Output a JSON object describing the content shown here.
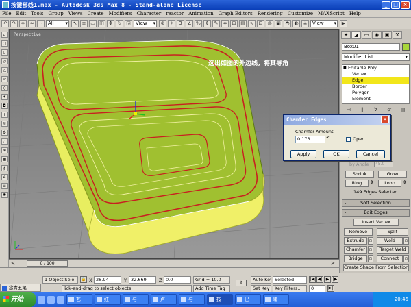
{
  "window": {
    "title": "按键部线1.max - Autodesk 3ds Max 8 - Stand-alone License",
    "min_label": "_",
    "max_label": "□",
    "close_label": "×"
  },
  "menu": [
    "File",
    "Edit",
    "Tools",
    "Group",
    "Views",
    "Create",
    "Modifiers",
    "Character",
    "reactor",
    "Animation",
    "Graph Editors",
    "Rendering",
    "Customize",
    "MAXScript",
    "Help"
  ],
  "toolbar": {
    "selection_filter": "All",
    "reference_coord": "View",
    "named_selection": "View"
  },
  "viewport": {
    "label": "Perspective",
    "annotation": "选出如图的外边线，将其导角",
    "body_color": "#a0c030",
    "edge_color": "#c82020",
    "highlight_color": "#f0f068"
  },
  "timeslider": {
    "frame": "0 / 100",
    "prev": "<",
    "next": ">"
  },
  "command_panel": {
    "tabs": [
      "✦",
      "◢",
      "▭",
      "◉",
      "▣",
      "⚒"
    ],
    "object_name": "Box01",
    "object_color": "#a8d63a",
    "modifier_list": "Modifier List",
    "stack": {
      "root": "Editable Poly",
      "items": [
        "Vertex",
        "Edge",
        "Border",
        "Polygon",
        "Element"
      ],
      "selected": "Edge"
    },
    "stack_tools": [
      "⊣",
      "‖",
      "∀",
      "♂",
      "▤"
    ],
    "by_angle_label": "by Angle",
    "by_angle_value": "45.0",
    "shrink": "Shrink",
    "grow": "Grow",
    "ring": "Ring",
    "loop": "Loop",
    "selection_info": "149 Edges Selected",
    "soft_selection": "Soft Selection",
    "edit_edges": "Edit Edges",
    "insert_vertex": "Insert Vertex",
    "remove": "Remove",
    "split": "Split",
    "extrude": "Extrude",
    "weld": "Weld",
    "chamfer": "Chamfer",
    "target_weld": "Target Weld",
    "bridge": "Bridge",
    "connect": "Connect",
    "create_shape": "Create Shape From Selection"
  },
  "dialog": {
    "title": "Chamfer Edges",
    "close": "×",
    "amount_label": "Chamfer Amount:",
    "amount_value": "0.173",
    "spinner": "▴▾",
    "open_label": "Open",
    "apply": "Apply",
    "ok": "OK",
    "cancel": "Cancel"
  },
  "statusbar": {
    "object_select": "1 Object Sele",
    "x_label": "X",
    "x_value": "28.94",
    "y_label": "Y",
    "y_value": "32.669",
    "z_label": "Z",
    "z_value": "0.0",
    "grid": "Grid = 10.0",
    "auto_key": "Auto Key",
    "selected": "Selected",
    "set_key": "Set Key",
    "key_filters": "Key Filters...",
    "prompt": "lick-and-drag to select objects",
    "add_time_tag": "Add Time Tag",
    "frame_value": "0",
    "playback": [
      "|◀",
      "◀|",
      "▶",
      "|▶",
      "▶|"
    ]
  },
  "ime": "念青五笔",
  "taskbar": {
    "start": "开始",
    "items": [
      "艺",
      "红",
      "与",
      "卢",
      "与",
      "按",
      "巳",
      "魂"
    ],
    "active_index": 5,
    "time": "20:46"
  }
}
